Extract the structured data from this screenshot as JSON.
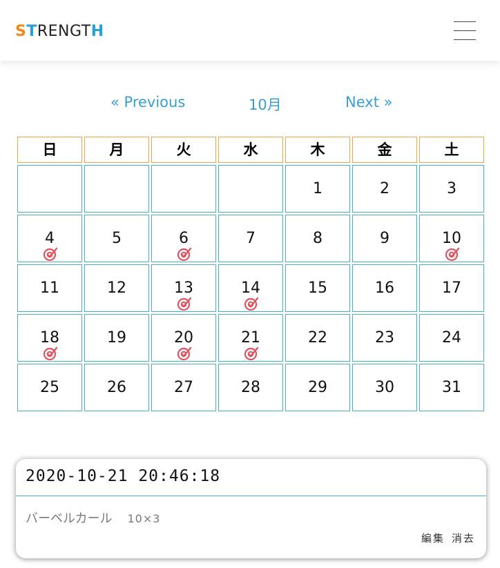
{
  "header": {
    "logo": {
      "s": "S",
      "t": "T",
      "middle": "RENGT",
      "h": "H"
    },
    "menu_icon": "hamburger-menu-icon"
  },
  "nav": {
    "previous": "« Previous",
    "month": "10月",
    "next": "Next »"
  },
  "calendar": {
    "weekdays": [
      "日",
      "月",
      "火",
      "水",
      "木",
      "金",
      "土"
    ],
    "weeks": [
      [
        {
          "d": ""
        },
        {
          "d": ""
        },
        {
          "d": ""
        },
        {
          "d": ""
        },
        {
          "d": "1"
        },
        {
          "d": "2"
        },
        {
          "d": "3"
        }
      ],
      [
        {
          "d": "4",
          "m": true
        },
        {
          "d": "5"
        },
        {
          "d": "6",
          "m": true
        },
        {
          "d": "7"
        },
        {
          "d": "8"
        },
        {
          "d": "9"
        },
        {
          "d": "10",
          "m": true
        }
      ],
      [
        {
          "d": "11"
        },
        {
          "d": "12"
        },
        {
          "d": "13",
          "m": true
        },
        {
          "d": "14",
          "m": true
        },
        {
          "d": "15"
        },
        {
          "d": "16"
        },
        {
          "d": "17"
        }
      ],
      [
        {
          "d": "18",
          "m": true
        },
        {
          "d": "19"
        },
        {
          "d": "20",
          "m": true
        },
        {
          "d": "21",
          "m": true
        },
        {
          "d": "22"
        },
        {
          "d": "23"
        },
        {
          "d": "24"
        }
      ],
      [
        {
          "d": "25"
        },
        {
          "d": "26"
        },
        {
          "d": "27"
        },
        {
          "d": "28"
        },
        {
          "d": "29"
        },
        {
          "d": "30"
        },
        {
          "d": "31"
        }
      ]
    ],
    "mark_icon": "target-check-icon",
    "colors": {
      "header_border": "#e7a545",
      "cell_border": "#49aec2",
      "mark": "#e0525e"
    }
  },
  "record": {
    "timestamp": "2020-10-21 20:46:18",
    "exercise": "バーベルカール",
    "reps": "10×3",
    "edit": "編集",
    "delete": "消去"
  }
}
